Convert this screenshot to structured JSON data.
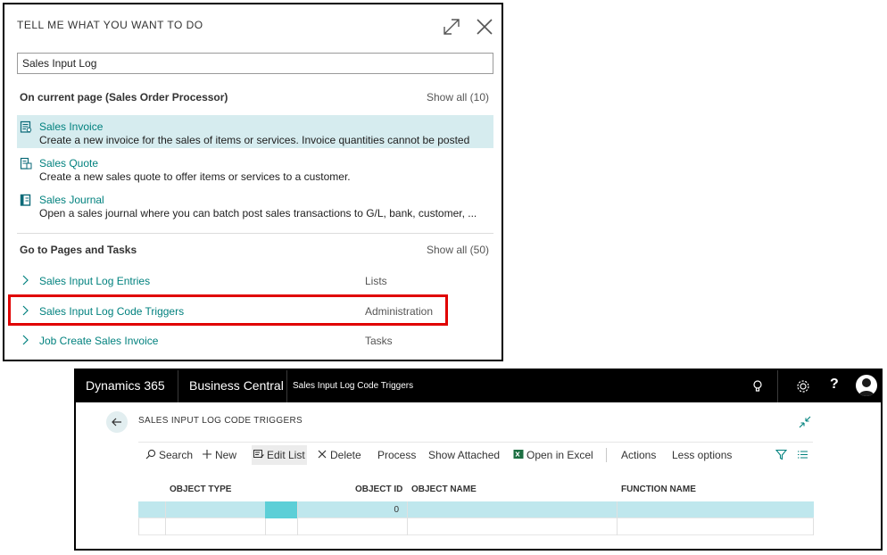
{
  "tell_me": {
    "header": "TELL ME WHAT YOU WANT TO DO",
    "search_value": "Sales Input Log",
    "current_page": {
      "title": "On current page (Sales Order Processor)",
      "show_all": "Show all (10)",
      "results": [
        {
          "icon": "invoice-icon",
          "title": "Sales Invoice",
          "description": "Create a new invoice for the sales of items or services. Invoice quantities cannot be posted"
        },
        {
          "icon": "quote-icon",
          "title": "Sales Quote",
          "description": "Create a new sales quote to offer items or services to a customer."
        },
        {
          "icon": "journal-icon",
          "title": "Sales Journal",
          "description": "Open a sales journal where you can batch post sales transactions to G/L, bank, customer, ..."
        }
      ]
    },
    "pages_tasks": {
      "title": "Go to Pages and Tasks",
      "show_all": "Show all (50)",
      "items": [
        {
          "title": "Sales Input Log Entries",
          "category": "Lists"
        },
        {
          "title": "Sales Input Log Code Triggers",
          "category": "Administration"
        },
        {
          "title": "Job Create Sales Invoice",
          "category": "Tasks"
        }
      ]
    }
  },
  "bc": {
    "brand": "Dynamics 365",
    "app": "Business Central",
    "breadcrumb": "Sales Input Log Code Triggers",
    "help": "?",
    "page_title": "SALES INPUT LOG CODE TRIGGERS",
    "actions": {
      "search": "Search",
      "new": "New",
      "edit_list": "Edit List",
      "delete": "Delete",
      "process": "Process",
      "show_attached": "Show Attached",
      "open_excel": "Open in Excel",
      "actions": "Actions",
      "less_options": "Less options"
    },
    "columns": [
      "OBJECT TYPE",
      "OBJECT ID",
      "OBJECT NAME",
      "FUNCTION NAME"
    ],
    "rows": [
      {
        "object_type": "",
        "object_id": "0",
        "object_name": "",
        "function_name": ""
      },
      {
        "object_type": "",
        "object_id": "",
        "object_name": "",
        "function_name": ""
      }
    ]
  },
  "colors": {
    "accent_teal": "#00817e",
    "selection": "#d6ecef",
    "highlight_red": "#e00000"
  }
}
